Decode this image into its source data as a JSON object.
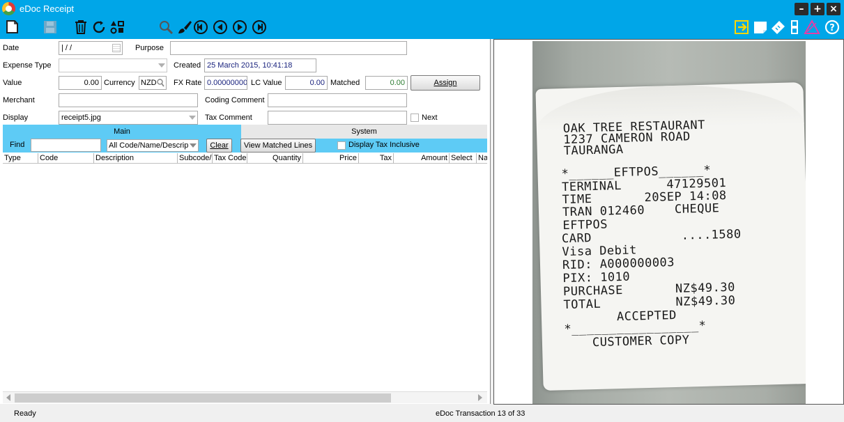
{
  "window": {
    "title": "eDoc Receipt"
  },
  "form": {
    "date_label": "Date",
    "date_value": "  |  /    /",
    "purpose_label": "Purpose",
    "purpose_value": "",
    "expense_type_label": "Expense Type",
    "expense_type_value": "",
    "created_label": "Created",
    "created_value": "25 March 2015, 10:41:18",
    "value_label": "Value",
    "value_value": "0.00",
    "currency_label": "Currency",
    "currency_value": "NZD",
    "fx_rate_label": "FX Rate",
    "fx_rate_value": "0.00000000",
    "lc_value_label": "LC Value",
    "lc_value_value": "0.00",
    "matched_label": "Matched",
    "matched_value": "0.00",
    "assign_label": "Assign",
    "merchant_label": "Merchant",
    "merchant_value": "",
    "coding_comment_label": "Coding Comment",
    "coding_comment_value": "",
    "display_label": "Display",
    "display_value": "receipt5.jpg",
    "tax_comment_label": "Tax Comment",
    "tax_comment_value": "",
    "next_label": "Next"
  },
  "tabs": {
    "main": "Main",
    "system": "System"
  },
  "filter": {
    "find_label": "Find",
    "find_value": "",
    "scope_value": "All Code/Name/Descrip",
    "clear_label": "Clear",
    "view_matched_label": "View Matched Lines",
    "tax_inclusive_label": "Display Tax Inclusive"
  },
  "grid": {
    "columns": [
      "Type",
      "Code",
      "Description",
      "Subcode/",
      "Tax Code",
      "Quantity",
      "Price",
      "Tax",
      "Amount",
      "Select",
      "Na"
    ]
  },
  "receipt": {
    "lines": [
      "OAK TREE RESTAURANT",
      "1237 CAMERON ROAD",
      "TAURANGA",
      "*______EFTPOS______*",
      "TERMINAL      47129501",
      "TIME       20SEP 14:08",
      "TRAN 012460    CHEQUE",
      "EFTPOS",
      "CARD            ....1580",
      "Visa Debit",
      "RID: A000000003",
      "PIX: 1010",
      "PURCHASE       NZ$49.30",
      "TOTAL          NZ$49.30",
      "ACCEPTED",
      "*_________________*",
      "CUSTOMER COPY"
    ]
  },
  "status": {
    "left": "Ready",
    "center": "eDoc Transaction 13 of 33"
  },
  "icons": {
    "toolbar_left": [
      "new-document-icon",
      "save-icon",
      "delete-icon",
      "refresh-icon",
      "shapes-icon",
      "search-icon",
      "brush-icon",
      "first-icon",
      "previous-icon",
      "next-icon",
      "last-icon"
    ],
    "toolbar_right": [
      "export-icon",
      "attach-icon",
      "tag-icon",
      "split-icon",
      "warning-icon",
      "help-icon"
    ]
  },
  "colors": {
    "accent": "#00a6e8",
    "tab_active": "#5ecbf5",
    "matched_green": "#2e7d32",
    "field_blue": "#1a237e"
  }
}
